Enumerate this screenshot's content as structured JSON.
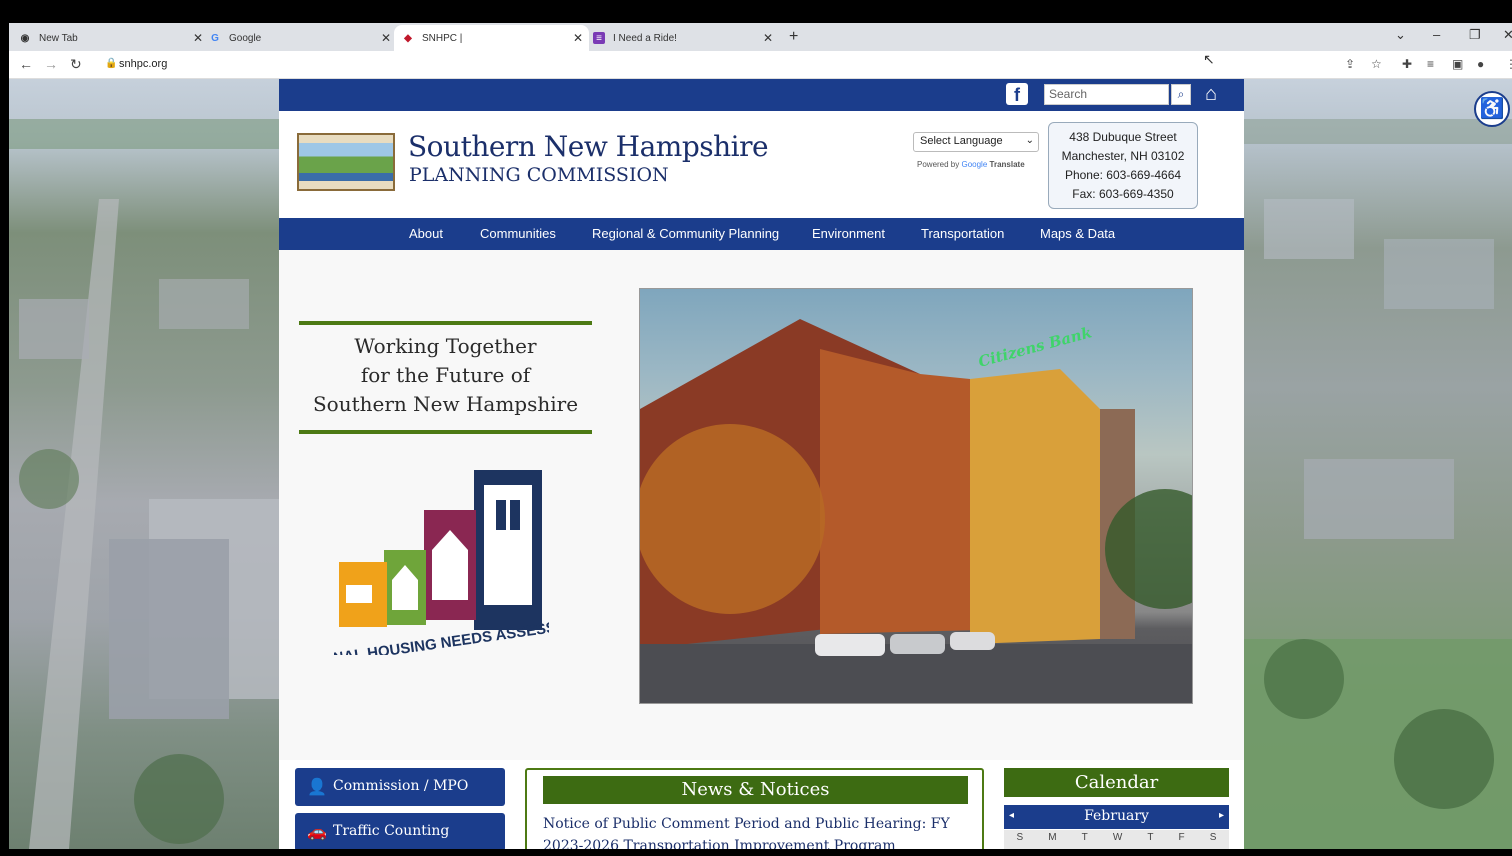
{
  "browser": {
    "tabs": [
      {
        "title": "New Tab",
        "icon": "chrome-icon"
      },
      {
        "title": "Google",
        "icon": "google-icon"
      },
      {
        "title": "SNHPC |",
        "icon": "snhpc-icon"
      },
      {
        "title": "I Need a Ride!",
        "icon": "form-icon"
      }
    ],
    "active_tab": 2,
    "url": "snhpc.org"
  },
  "site": {
    "search_placeholder": "Search",
    "org_name_line1": "Southern New Hampshire",
    "org_name_line2": "PLANNING COMMISSION",
    "language_select": "Select Language",
    "powered_by": "Powered by",
    "translate_brand": "Google",
    "translate_word": "Translate",
    "contact": {
      "street": "438 Dubuque Street",
      "city": "Manchester, NH 03102",
      "phone": "Phone: 603-669-4664",
      "fax": "Fax: 603-669-4350"
    },
    "nav": [
      "About",
      "Communities",
      "Regional & Community Planning",
      "Environment",
      "Transportation",
      "Maps & Data"
    ],
    "tagline": [
      "Working Together",
      "for the Future of",
      "Southern New Hampshire"
    ],
    "rhna_text": "REGIONAL HOUSING NEEDS ASSESSMENT",
    "photo_sign": "Citizens Bank",
    "side_buttons": [
      {
        "label": "Commission / MPO",
        "icon": "person-icon"
      },
      {
        "label": "Traffic Counting",
        "icon": "car-icon"
      }
    ],
    "news": {
      "title": "News & Notices",
      "item": "Notice of Public Comment Period and Public Hearing: FY 2023-2026 Transportation Improvement Program"
    },
    "calendar": {
      "title": "Calendar",
      "month": "February",
      "days": [
        "S",
        "M",
        "T",
        "W",
        "T",
        "F",
        "S"
      ]
    }
  },
  "colors": {
    "navy": "#1b3d8c",
    "green": "#3d6b12"
  }
}
